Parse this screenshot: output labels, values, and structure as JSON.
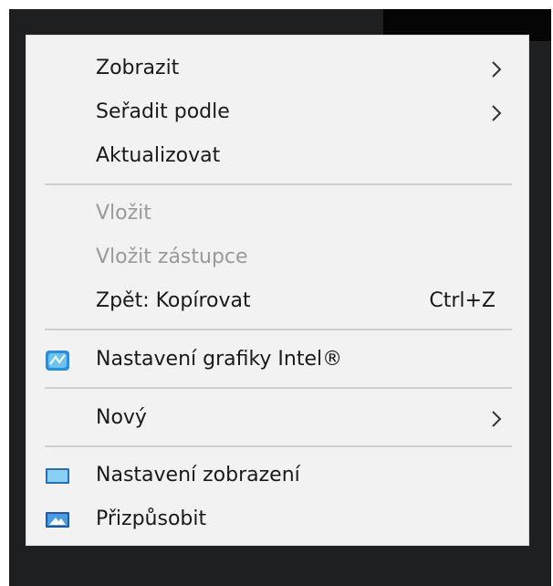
{
  "context_menu": {
    "items": [
      {
        "label": "Zobrazit",
        "has_submenu": true
      },
      {
        "label": "Seřadit podle",
        "has_submenu": true
      },
      {
        "label": "Aktualizovat"
      },
      {
        "label": "Vložit",
        "disabled": true
      },
      {
        "label": "Vložit zástupce",
        "disabled": true
      },
      {
        "label": "Zpět: Kopírovat",
        "shortcut": "Ctrl+Z"
      },
      {
        "label": "Nastavení grafiky Intel®",
        "icon": "intel-graphics-icon"
      },
      {
        "label": "Nový",
        "has_submenu": true
      },
      {
        "label": "Nastavení zobrazení",
        "icon": "display-settings-icon"
      },
      {
        "label": "Přizpůsobit",
        "icon": "personalize-icon"
      }
    ]
  },
  "colors": {
    "menu_background": "#f2f2f2",
    "disabled_text": "#9a9a9a",
    "separator": "#cfcfcf"
  }
}
